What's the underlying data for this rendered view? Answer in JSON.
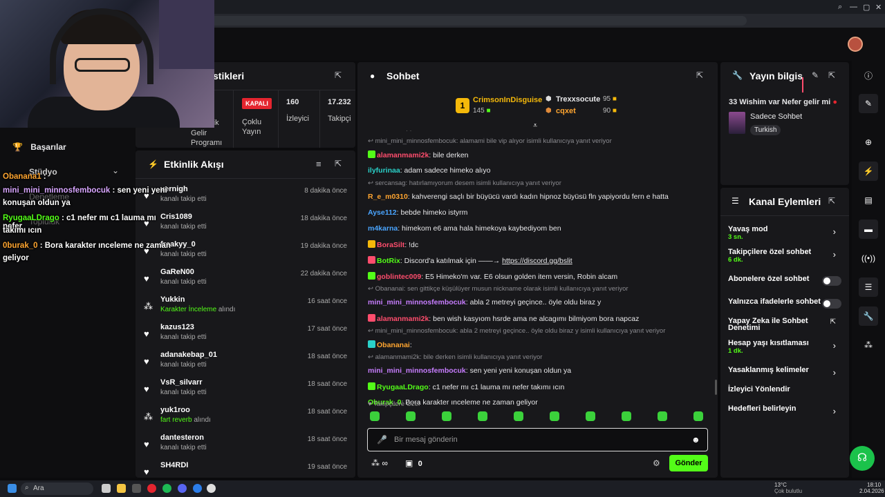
{
  "browser": {
    "controls": [
      "⌕",
      "—",
      "▢",
      "✕"
    ]
  },
  "left_nav": {
    "items": [
      {
        "label": "Başarılar"
      },
      {
        "label": "Stüdyo"
      },
      {
        "label": "Denetleme"
      },
      {
        "label": "Topluluk"
      }
    ]
  },
  "stats": {
    "title": "İstatistikler",
    "title_visible": "stikleri",
    "cells": [
      {
        "top": "",
        "label": "Ödül Geliştirme Programı",
        "label_visible": "rik",
        "label2": "Gelir",
        "label3": "Programı"
      },
      {
        "top": "KAPALI",
        "label": "Çoklu",
        "label2": "Yayın"
      },
      {
        "top": "160",
        "label": "İzleyici"
      },
      {
        "top": "17.232",
        "label": "Takipçi"
      }
    ]
  },
  "activity": {
    "title": "Etkinlik Akışı",
    "items": [
      {
        "user": "vernigh",
        "sub": "kanalı takip etti",
        "time": "8 dakika önce",
        "icon": "heart"
      },
      {
        "user": "Cris1089",
        "sub": "kanalı takip etti",
        "time": "18 dakika önce",
        "icon": "heart"
      },
      {
        "user": "freakyy_0",
        "sub": "kanalı takip etti",
        "time": "19 dakika önce",
        "icon": "heart"
      },
      {
        "user": "GaReN00",
        "sub": "kanalı takip etti",
        "time": "22 dakika önce",
        "icon": "heart"
      },
      {
        "user": "Yukkin",
        "sub_hl": "Karakter İnceleme",
        "sub_rest": " alındı",
        "time": "16 saat önce",
        "icon": "reward"
      },
      {
        "user": "kazus123",
        "sub": "kanalı takip etti",
        "time": "17 saat önce",
        "icon": "heart"
      },
      {
        "user": "adanakebap_01",
        "sub": "kanalı takip etti",
        "time": "18 saat önce",
        "icon": "heart"
      },
      {
        "user": "VsR_silvarr",
        "sub": "kanalı takip etti",
        "time": "18 saat önce",
        "icon": "heart"
      },
      {
        "user": "yuk1roo",
        "sub_hl": "fart reverb",
        "sub_rest": " alındı",
        "time": "18 saat önce",
        "icon": "reward"
      },
      {
        "user": "dantesteron",
        "sub": "kanalı takip etti",
        "time": "18 saat önce",
        "icon": "heart"
      },
      {
        "user": "SH4RDI",
        "sub": "",
        "time": "19 saat önce",
        "icon": "heart"
      }
    ]
  },
  "chat": {
    "title": "Sohbet",
    "leaders": [
      {
        "rank": "1",
        "name": "CrimsonInDisguise",
        "count": "145"
      },
      {
        "name": "Trexxsocute",
        "count": "95"
      },
      {
        "name": "cqxet",
        "count": "90"
      }
    ],
    "dots": "· ·",
    "messages": [
      {
        "reply": "mini_mini_minnosfembocuk: alamami bile vip alıyor isimli kullanıcıya yanıt veriyor"
      },
      {
        "user": "alamanmami2k",
        "cls": "u-red",
        "text": ": bile derken"
      },
      {
        "user": "ilyfurinaa",
        "cls": "u-teal",
        "text": ": adam sadece himeko alıyo"
      },
      {
        "reply": "sercansag: hatırlamıyorum desem isimli kullanıcıya yanıt veriyor"
      },
      {
        "user": "R_e_m0310",
        "cls": "u-orange",
        "text": ": kahverengi saçlı bir büyücü vardı kadın hipnoz büyüsü fln yapiyordu fern e hatta"
      },
      {
        "user": "Ayse112",
        "cls": "u-blue",
        "text": ": bebde himeko istyrm"
      },
      {
        "user": "m4karna",
        "cls": "u-blue",
        "text": ": himekom e6 ama hala himekoya kaybediyom ben"
      },
      {
        "user": "BoraSilt",
        "cls": "u-red",
        "text": ": !dc"
      },
      {
        "user": "BotRix",
        "cls": "u-green",
        "text": ": Discord'a katılmak için ——→ ",
        "link": "https://discord.gg/bslit"
      },
      {
        "user": "goblintec009",
        "cls": "u-red",
        "text": ": E5 Himeko'm var. E6 olsun golden item versin, Robin alcam"
      },
      {
        "reply": "Obananai: sen gittikçe küşülüyer musun nickname olarak isimli kullanıcıya yanıt veriyor"
      },
      {
        "user": "mini_mini_minnosfembocuk",
        "cls": "u-purple",
        "text": ": abla 2 metreyi geçince.. öyle oldu biraz y"
      },
      {
        "user": "alamanmami2k",
        "cls": "u-red",
        "text": ": ben wish kasyıom hsrde ama ne alcagımı bilmiyom bora napcaz"
      },
      {
        "reply": "mini_mini_minnosfembocuk: abla 2 metreyi geçince.. öyle oldu biraz y isimli kullanıcıya yanıt veriyor"
      },
      {
        "user": "Obananai",
        "cls": "u-orange",
        "text": ":"
      },
      {
        "reply": "alamanmami2k: bile derken isimli kullanıcıya yanıt veriyor"
      },
      {
        "user": "mini_mini_minnosfembocuk",
        "cls": "u-purple",
        "text": ": sen yeni yeni konuşan oldun ya"
      },
      {
        "user": "RyugaaLDrago",
        "cls": "u-green",
        "text": ": c1 nefer mı c1 lauma mı nefer takımı ıcın"
      },
      {
        "user": "Oburak_0",
        "cls": "u-green",
        "text": ": Bora karakter ınceleme ne zaman geliyor"
      }
    ],
    "followers_only": "Takipçilere Özel",
    "input_placeholder": "Bir mesaj gönderin",
    "points": "∞",
    "gift_count": "0",
    "send_label": "Gönder"
  },
  "stream_info": {
    "title": "Yayın bilgisi",
    "title_visible": "Yayın bilgis",
    "stream_title": "33 Wishim var Nefer gelir mi",
    "category": "Sadece Sohbet",
    "tag": "Turkish"
  },
  "channel_actions": {
    "title": "Kanal Eylemleri",
    "items": [
      {
        "label": "Yavaş mod",
        "sub": "3 sn.",
        "kind": "chev"
      },
      {
        "label": "Takipçilere özel sohbet",
        "sub": "6 dk.",
        "kind": "chev"
      },
      {
        "label": "Abonelere özel sohbet",
        "kind": "toggle"
      },
      {
        "label": "Yalnızca ifadelerle sohbet",
        "kind": "toggle"
      },
      {
        "label": "Yapay Zeka ile Sohbet",
        "label2": "Denetimi",
        "kind": "ext"
      },
      {
        "label": "Hesap yaşı kısıtlaması",
        "sub": "1 dk.",
        "kind": "chev"
      },
      {
        "label": "Yasaklanmış kelimeler",
        "kind": "chev"
      },
      {
        "label": "İzleyici Yönlendir",
        "kind": "none"
      },
      {
        "label": "Hedefleri belirleyin",
        "kind": "chev"
      }
    ]
  },
  "overlay_chat": [
    {
      "user": "Obanana1",
      "text": " :"
    },
    {
      "user": "mini_mini_minnosfembocuk",
      "text": " : sen yeni yeni"
    },
    {
      "text": "konuşan oldun ya"
    },
    {
      "user": "RyugaaLDrago",
      "text": " : c1 nefer mı c1 lauma mı nefer"
    },
    {
      "text": "takımı ıcın"
    },
    {
      "user": "0burak_0",
      "text": " : Bora karakter ınceleme ne zaman"
    },
    {
      "text": "geliyor"
    }
  ],
  "taskbar": {
    "search": "Ara",
    "weather": "13°C",
    "weather_sub": "Çok bulutlu",
    "time": "18:10",
    "date": "2.04.2026"
  },
  "colors": {
    "accent": "#53fc18",
    "panel": "#18181b",
    "bg": "#0e0e10"
  }
}
